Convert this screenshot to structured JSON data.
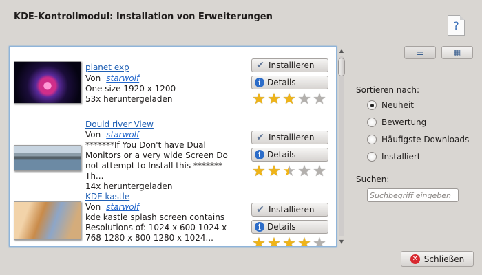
{
  "window": {
    "title": "KDE-Kontrollmodul: Installation von Erweiterungen",
    "help_icon": "?"
  },
  "view_switch": [
    {
      "name": "detail-view",
      "icon": "list-icon"
    },
    {
      "name": "icon-view",
      "icon": "grid-icon"
    }
  ],
  "items": [
    {
      "title": "planet exp",
      "by": "Von",
      "author": "starwolf",
      "lines": [
        "One size 1920 x 1200"
      ],
      "downloads": "53x heruntergeladen",
      "rating": 3,
      "install_label": "Installieren",
      "details_label": "Details"
    },
    {
      "title": "Dould river View",
      "by": "Von",
      "author": "starwolf",
      "lines": [
        "*******If You Don't have Dual",
        "Monitors or a very wide Screen Do",
        "not attempt to Install this *******",
        "Th..."
      ],
      "downloads": "14x heruntergeladen",
      "rating": 2.5,
      "install_label": "Installieren",
      "details_label": "Details"
    },
    {
      "title": "KDE kastle",
      "by": "Von",
      "author": "starwolf",
      "lines": [
        "kde kastle splash screen contains",
        "Resolutions of: 1024 x 600 1024 x",
        "768 1280 x 800 1280 x 1024..."
      ],
      "downloads": "",
      "rating": 4,
      "install_label": "Installieren",
      "details_label": "Details"
    }
  ],
  "sort": {
    "label": "Sortieren nach:",
    "options": [
      "Neuheit",
      "Bewertung",
      "Häufigste Downloads",
      "Installiert"
    ],
    "selected": "Neuheit"
  },
  "search": {
    "label": "Suchen:",
    "placeholder": "Suchbegriff eingeben"
  },
  "close_label": "Schließen",
  "colors": {
    "link": "#1f5fb4",
    "star": "#f0b417",
    "background": "#d9d6d2"
  }
}
